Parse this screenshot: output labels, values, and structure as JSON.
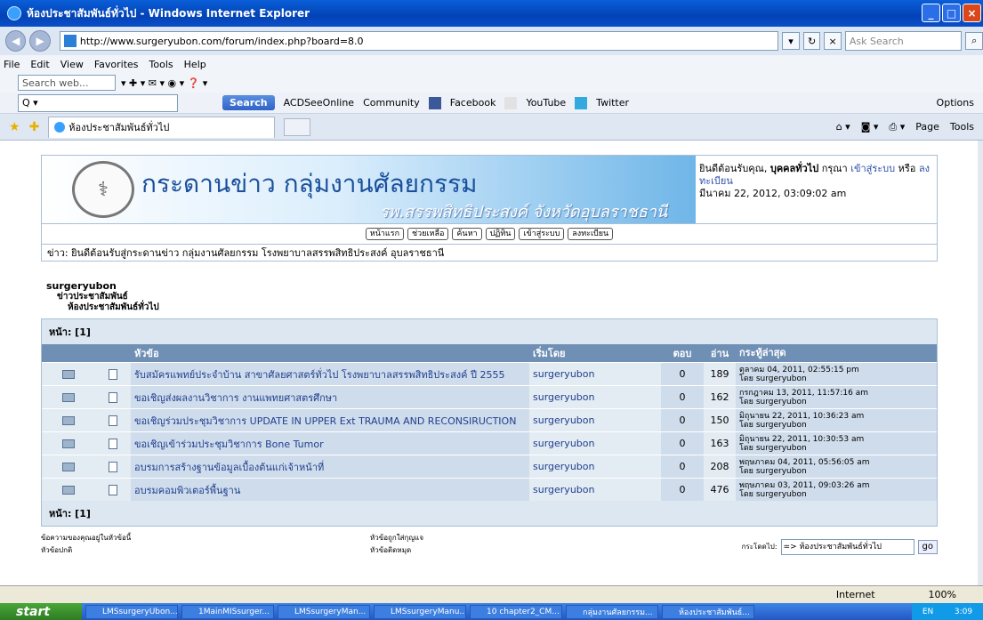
{
  "window": {
    "title": "ห้องประชาสัมพันธ์ทั่วไป - Windows Internet Explorer"
  },
  "address": {
    "url": "http://www.surgeryubon.com/forum/index.php?board=8.0",
    "search_placeholder": "Ask Search"
  },
  "menu": [
    "File",
    "Edit",
    "View",
    "Favorites",
    "Tools",
    "Help"
  ],
  "toolbar1": {
    "search_web": "Search web..."
  },
  "toolbar2": {
    "search_label": "Search",
    "links": [
      "ACDSeeOnline",
      "Community",
      "Facebook",
      "YouTube",
      "Twitter"
    ],
    "options": "Options"
  },
  "tab": {
    "title": "ห้องประชาสัมพันธ์ทั่วไป"
  },
  "tabtools": {
    "page": "Page",
    "tools": "Tools"
  },
  "banner": {
    "title": "กระดานข่าว กลุ่มงานศัลยกรรม",
    "subtitle": "รพ.สรรพสิทธิประสงค์ จังหวัดอุบลราชธานี"
  },
  "user": {
    "welcome": "ยินดีต้อนรับคุณ,",
    "name": "บุคคลทั่วไป",
    "please": "กรุณา",
    "login": "เข้าสู่ระบบ",
    "or": "หรือ",
    "register": "ลงทะเบียน",
    "datetime": "มีนาคม 22, 2012, 03:09:02 am"
  },
  "forum_menu": [
    "หน้าแรก",
    "ช่วยเหลือ",
    "ค้นหา",
    "ปฏิทิน",
    "เข้าสู่ระบบ",
    "ลงทะเบียน"
  ],
  "news": "ข่าว: ยินดีต้อนรับสู่กระดานข่าว กลุ่มงานศัลยกรรม โรงพยาบาลสรรพสิทธิประสงค์ อุบลราชธานี",
  "tree": [
    "surgeryubon",
    "ข่าวประชาสัมพันธ์",
    "ห้องประชาสัมพันธ์ทั่วไป"
  ],
  "pages": "หน้า: [1]",
  "headers": {
    "subject": "หัวข้อ",
    "started_by": "เริ่มโดย",
    "replies": "ตอบ",
    "views": "อ่าน",
    "last_post": "กระทู้ล่าสุด"
  },
  "topics": [
    {
      "subject": "รับสมัครแพทย์ประจำบ้าน สาขาศัลยศาสตร์ทั่วไป โรงพยาบาลสรรพสิทธิประสงค์ ปี 2555",
      "by": "surgeryubon",
      "replies": "0",
      "views": "189",
      "last": "ตุลาคม 04, 2011, 02:55:15 pm",
      "last_by": "โดย surgeryubon"
    },
    {
      "subject": "ขอเชิญส่งผลงานวิชาการ งานแพทยศาสตรศึกษา",
      "by": "surgeryubon",
      "replies": "0",
      "views": "162",
      "last": "กรกฎาคม 13, 2011, 11:57:16 am",
      "last_by": "โดย surgeryubon"
    },
    {
      "subject": "ขอเชิญร่วมประชุมวิชาการ UPDATE IN UPPER Ext TRAUMA AND RECONSIRUCTION",
      "by": "surgeryubon",
      "replies": "0",
      "views": "150",
      "last": "มิถุนายน 22, 2011, 10:36:23 am",
      "last_by": "โดย surgeryubon"
    },
    {
      "subject": "ขอเชิญเข้าร่วมประชุมวิชาการ Bone Tumor",
      "by": "surgeryubon",
      "replies": "0",
      "views": "163",
      "last": "มิถุนายน 22, 2011, 10:30:53 am",
      "last_by": "โดย surgeryubon"
    },
    {
      "subject": "อบรมการสร้างฐานข้อมูลเบื้องต้นแก่เจ้าหน้าที่",
      "by": "surgeryubon",
      "replies": "0",
      "views": "208",
      "last": "พฤษภาคม 04, 2011, 05:56:05 am",
      "last_by": "โดย surgeryubon"
    },
    {
      "subject": "อบรมคอมพิวเตอร์พื้นฐาน",
      "by": "surgeryubon",
      "replies": "0",
      "views": "476",
      "last": "พฤษภาคม 03, 2011, 09:03:26 am",
      "last_by": "โดย surgeryubon"
    }
  ],
  "pages_bottom": "หน้า: [1]",
  "legend": {
    "participated": "ข้อความของคุณอยู่ในหัวข้อนี้",
    "normal": "หัวข้อปกติ",
    "locked": "หัวข้อถูกใส่กุญแจ",
    "sticky": "หัวข้อติดหมุด"
  },
  "jump": {
    "label": "กระโดดไป:",
    "selected": "=> ห้องประชาสัมพันธ์ทั่วไป",
    "go": "go"
  },
  "status": {
    "zone": "Internet",
    "zoom": "100%"
  },
  "taskbar": {
    "start": "start",
    "items": [
      "LMSsurgeryUbon...",
      "1MainMISsurger...",
      "LMSsurgeryMan...",
      "LMSsurgeryManu...",
      "10 chapter2_CM...",
      "กลุ่มงานศัลยกรรม...",
      "ห้องประชาสัมพันธ์..."
    ],
    "lang": "EN",
    "time": "3:09"
  }
}
